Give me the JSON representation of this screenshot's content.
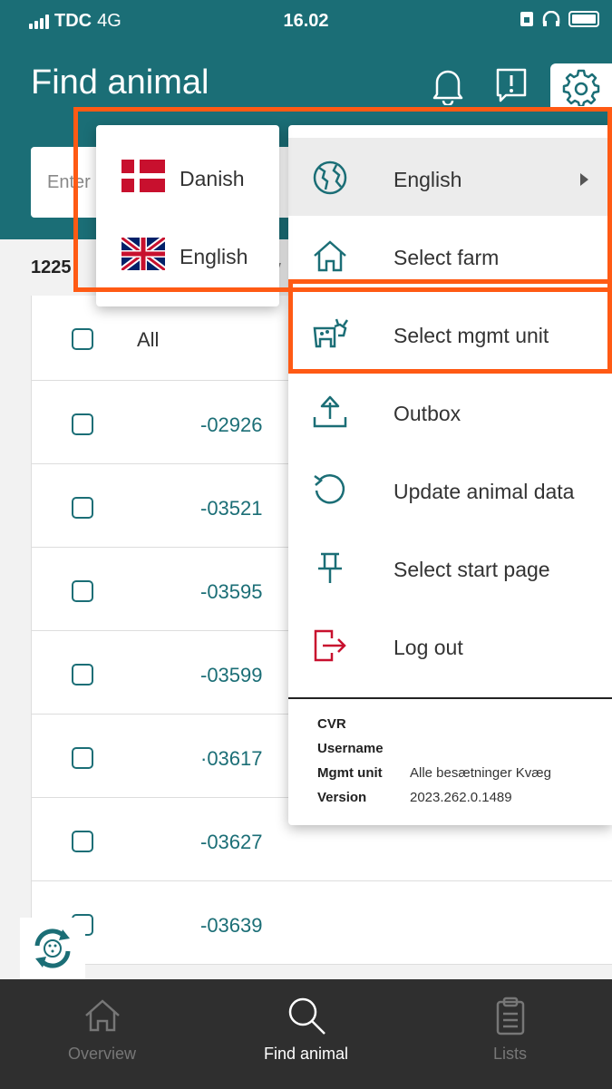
{
  "status_bar": {
    "carrier": "TDC",
    "network": "4G",
    "time": "16.02"
  },
  "header": {
    "title": "Find animal"
  },
  "search": {
    "placeholder": "Enter"
  },
  "count": {
    "value": "1225",
    "extra": "v"
  },
  "list": {
    "select_all_label": "All",
    "rows": [
      "-02926",
      "-03521",
      "-03595",
      "-03599",
      "·03617",
      "-03627",
      "-03639"
    ]
  },
  "settings_menu": {
    "items": [
      {
        "label": "English",
        "icon": "globe-icon",
        "has_submenu": true
      },
      {
        "label": "Select farm",
        "icon": "house-icon"
      },
      {
        "label": "Select mgmt unit",
        "icon": "cow-icon"
      },
      {
        "label": "Outbox",
        "icon": "outbox-icon"
      },
      {
        "label": "Update animal data",
        "icon": "refresh-icon"
      },
      {
        "label": "Select start page",
        "icon": "pin-icon"
      },
      {
        "label": "Log out",
        "icon": "logout-icon"
      }
    ],
    "info": [
      {
        "key": "CVR",
        "value": ""
      },
      {
        "key": "Username",
        "value": ""
      },
      {
        "key": "Mgmt unit",
        "value": "Alle besætninger Kvæg"
      },
      {
        "key": "Version",
        "value": "2023.262.0.1489"
      }
    ]
  },
  "language_menu": {
    "items": [
      {
        "label": "Danish",
        "flag": "danish-flag-icon"
      },
      {
        "label": "English",
        "flag": "uk-flag-icon"
      }
    ]
  },
  "bottom_nav": {
    "items": [
      {
        "label": "Overview",
        "icon": "home-icon",
        "active": false
      },
      {
        "label": "Find animal",
        "icon": "search-icon",
        "active": true
      },
      {
        "label": "Lists",
        "icon": "clipboard-icon",
        "active": false
      }
    ]
  },
  "colors": {
    "primary": "#1b6e76",
    "highlight": "#ff5a14",
    "danger": "#c8102e",
    "nav_bg": "#2f2f2f"
  }
}
